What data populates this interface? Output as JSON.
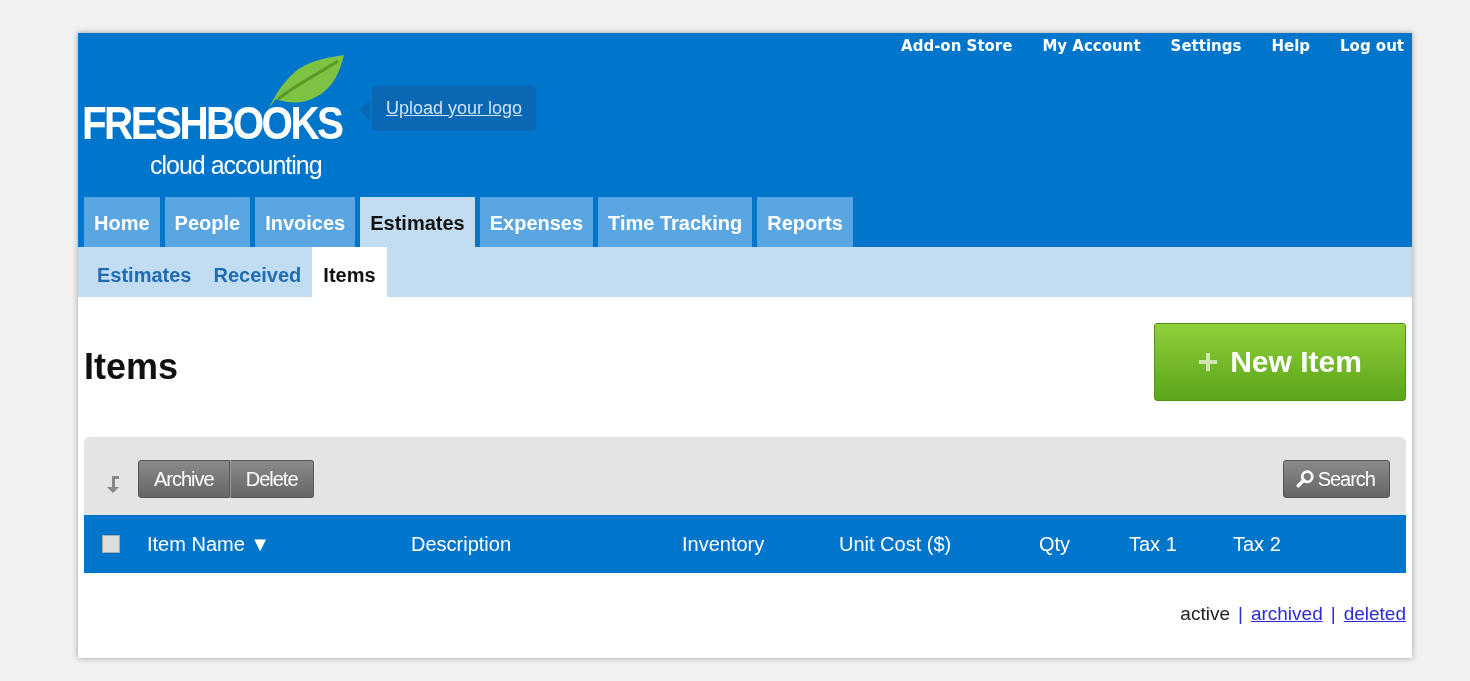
{
  "top_links": [
    "Add-on Store",
    "My Account",
    "Settings",
    "Help",
    "Log out"
  ],
  "logo": {
    "name": "FRESHBOOKS",
    "tagline": "cloud accounting"
  },
  "upload_logo": "Upload your logo",
  "tabs": [
    {
      "label": "Home",
      "selected": false
    },
    {
      "label": "People",
      "selected": false
    },
    {
      "label": "Invoices",
      "selected": false
    },
    {
      "label": "Estimates",
      "selected": true
    },
    {
      "label": "Expenses",
      "selected": false
    },
    {
      "label": "Time Tracking",
      "selected": false
    },
    {
      "label": "Reports",
      "selected": false
    }
  ],
  "subtabs": [
    {
      "label": "Estimates",
      "selected": false
    },
    {
      "label": "Received",
      "selected": false
    },
    {
      "label": "Items",
      "selected": true
    }
  ],
  "page_title": "Items",
  "new_button": "New Item",
  "toolbar": {
    "actions": [
      "Archive",
      "Delete"
    ],
    "search": "Search"
  },
  "table": {
    "select_all_checked": false,
    "columns": [
      {
        "label": "Item Name",
        "sort": "▼"
      },
      {
        "label": "Description"
      },
      {
        "label": "Inventory"
      },
      {
        "label": "Unit Cost ($)"
      },
      {
        "label": "Qty"
      },
      {
        "label": "Tax 1"
      },
      {
        "label": "Tax 2"
      }
    ]
  },
  "filters": [
    {
      "kind": "filter",
      "label": "active",
      "selected": true
    },
    {
      "kind": "separator",
      "text": "|"
    },
    {
      "kind": "filter",
      "label": "archived",
      "selected": false
    },
    {
      "kind": "separator",
      "text": "|"
    },
    {
      "kind": "filter",
      "label": "deleted",
      "selected": false
    }
  ]
}
